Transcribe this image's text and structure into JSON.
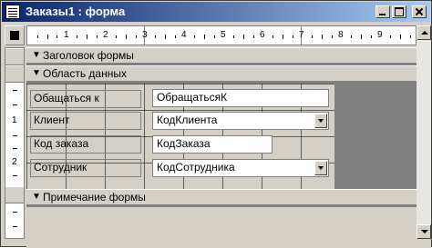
{
  "window": {
    "title": "Заказы1 : форма"
  },
  "ruler": {
    "h_numbers": [
      "1",
      "2",
      "3",
      "4",
      "5",
      "6",
      "7",
      "8",
      "9"
    ],
    "v_numbers": [
      "1",
      "2"
    ]
  },
  "sections": {
    "header": "Заголовок формы",
    "detail": "Область данных",
    "footer": "Примечание формы"
  },
  "fields": [
    {
      "label": "Обащаться к",
      "control": "ОбращатьсяК",
      "combo": false
    },
    {
      "label": "Клиент",
      "control": "КодКлиента",
      "combo": true
    },
    {
      "label": "Код заказа",
      "control": "КодЗаказа",
      "combo": false
    },
    {
      "label": "Сотрудник",
      "control": "КодСотрудника",
      "combo": true
    }
  ],
  "colors": {
    "titlebar_start": "#0a246a",
    "titlebar_end": "#a6caf0",
    "face": "#d4d0c8",
    "workspace": "#808080"
  }
}
